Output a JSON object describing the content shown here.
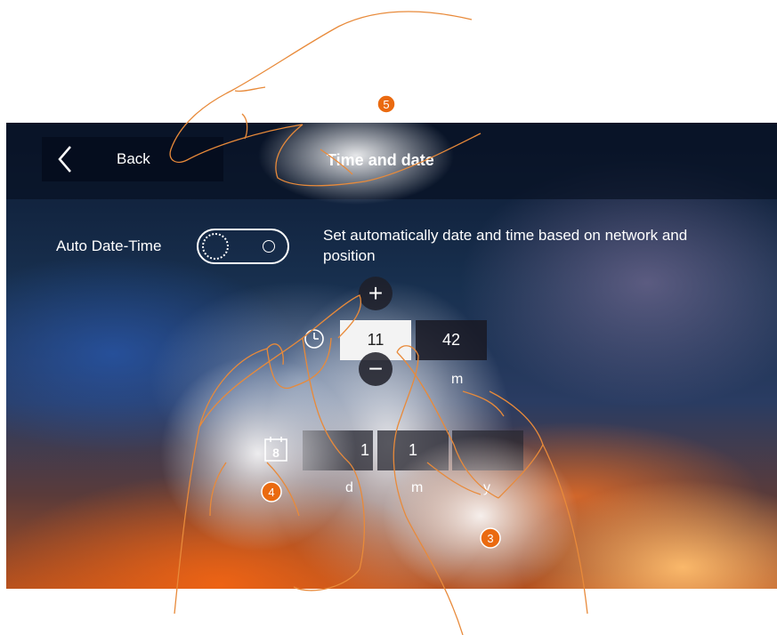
{
  "header": {
    "back_label": "Back",
    "title": "Time and date"
  },
  "auto": {
    "label": "Auto Date-Time",
    "description": "Set automatically date and time based on network and position",
    "enabled": false
  },
  "time": {
    "hour": "11",
    "minute": "42",
    "minute_unit": "m",
    "increment_symbol": "+",
    "decrement_symbol": "−"
  },
  "date": {
    "calendar_icon_number": "8",
    "day": "1",
    "month": "1",
    "day_unit": "d",
    "month_unit": "m",
    "year_unit": "y"
  },
  "callouts": [
    "5",
    "4",
    "3"
  ],
  "icons": [
    "back-chevron-icon",
    "clock-icon",
    "calendar-icon",
    "plus-icon",
    "minus-icon"
  ],
  "colors": {
    "accent": "#ea6a10",
    "topbar": "#081224",
    "highlight_box": "#f3f3f3"
  }
}
